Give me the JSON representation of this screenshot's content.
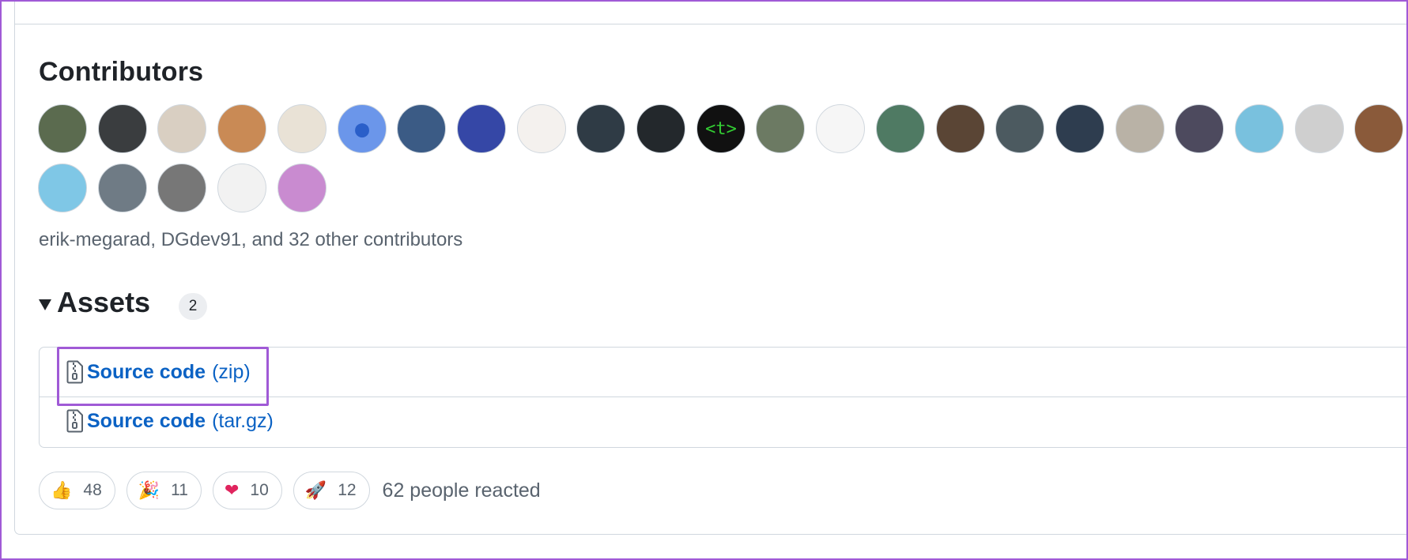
{
  "contributors": {
    "title": "Contributors",
    "summary": "erik-megarad, DGdev91, and 32 other contributors",
    "avatars": [
      {
        "name": "avatar-1",
        "bg": "#5b6b4f",
        "glyph": ""
      },
      {
        "name": "avatar-2",
        "bg": "#3a3d3f",
        "glyph": ""
      },
      {
        "name": "avatar-3",
        "bg": "#d9cfc2",
        "glyph": ""
      },
      {
        "name": "avatar-4",
        "bg": "#c98a55",
        "glyph": ""
      },
      {
        "name": "avatar-5",
        "bg": "#e9e2d6",
        "glyph": ""
      },
      {
        "name": "avatar-6",
        "bg": "#6b96ea",
        "glyph": "●"
      },
      {
        "name": "avatar-7",
        "bg": "#3b5b85",
        "glyph": ""
      },
      {
        "name": "avatar-8",
        "bg": "#3547a6",
        "glyph": ""
      },
      {
        "name": "avatar-9",
        "bg": "#f4f1ee",
        "glyph": ""
      },
      {
        "name": "avatar-10",
        "bg": "#2f3b45",
        "glyph": ""
      },
      {
        "name": "avatar-11",
        "bg": "#23282c",
        "glyph": ""
      },
      {
        "name": "avatar-12",
        "bg": "#111111",
        "glyph": "<t>"
      },
      {
        "name": "avatar-13",
        "bg": "#6c7a63",
        "glyph": ""
      },
      {
        "name": "avatar-14",
        "bg": "#f6f6f6",
        "glyph": ""
      },
      {
        "name": "avatar-15",
        "bg": "#4f7a63",
        "glyph": ""
      },
      {
        "name": "avatar-16",
        "bg": "#5a4535",
        "glyph": ""
      },
      {
        "name": "avatar-17",
        "bg": "#4c5a60",
        "glyph": ""
      },
      {
        "name": "avatar-18",
        "bg": "#2e3d4f",
        "glyph": ""
      },
      {
        "name": "avatar-19",
        "bg": "#b9b2a6",
        "glyph": ""
      },
      {
        "name": "avatar-20",
        "bg": "#4d4a5e",
        "glyph": ""
      },
      {
        "name": "avatar-21",
        "bg": "#79c1de",
        "glyph": ""
      },
      {
        "name": "avatar-22",
        "bg": "#cfcfcf",
        "glyph": ""
      },
      {
        "name": "avatar-23",
        "bg": "#8a5a3a",
        "glyph": ""
      },
      {
        "name": "avatar-24",
        "bg": "#7fc7e6",
        "glyph": ""
      },
      {
        "name": "avatar-25",
        "bg": "#6f7b85",
        "glyph": ""
      },
      {
        "name": "avatar-26",
        "bg": "#777777",
        "glyph": ""
      },
      {
        "name": "avatar-27",
        "bg": "#f2f2f2",
        "glyph": ""
      },
      {
        "name": "avatar-28",
        "bg": "#c98bd0",
        "glyph": ""
      }
    ]
  },
  "assets": {
    "title": "Assets",
    "count": "2",
    "items": [
      {
        "name": "Source code",
        "ext": "(zip)"
      },
      {
        "name": "Source code",
        "ext": "(tar.gz)"
      }
    ]
  },
  "reactions": {
    "items": [
      {
        "emoji": "👍",
        "count": "48"
      },
      {
        "emoji": "🎉",
        "count": "11"
      },
      {
        "emoji": "❤",
        "count": "10"
      },
      {
        "emoji": "🚀",
        "count": "12"
      }
    ],
    "summary": "62 people reacted"
  },
  "colors": {
    "link": "#0b62c4",
    "highlight": "#a05ad6",
    "muted": "#59636e"
  }
}
